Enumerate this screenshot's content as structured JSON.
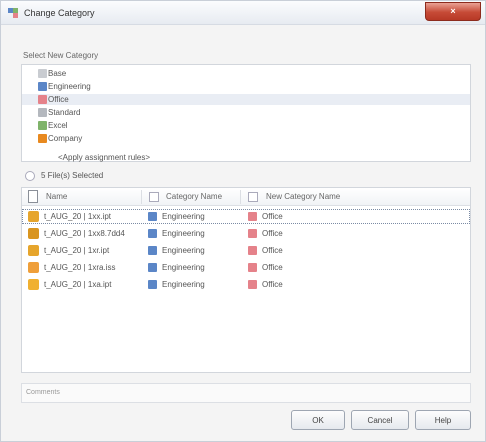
{
  "window": {
    "title": "Change Category",
    "close_label": "×"
  },
  "section": {
    "select_new_category": "Select New Category",
    "comments": "Comments"
  },
  "categories": [
    {
      "label": "Base",
      "color": "#c9ccd1"
    },
    {
      "label": "Engineering",
      "color": "#5b86c7"
    },
    {
      "label": "Office",
      "color": "#e5828a"
    },
    {
      "label": "Standard",
      "color": "#b4b8be"
    },
    {
      "label": "Excel",
      "color": "#7fb36a"
    },
    {
      "label": "Company",
      "color": "#e8891f"
    }
  ],
  "apply_rules_label": "<Apply assignment rules>",
  "files": {
    "count_label": "5 File(s) Selected",
    "columns": {
      "name": "Name",
      "category_name": "Category Name",
      "new_category_name": "New Category Name"
    },
    "rows": [
      {
        "name": "t_AUG_20 | 1xx.ipt",
        "category": "Engineering",
        "new_category": "Office",
        "icon_color": "#e6a52c"
      },
      {
        "name": "t_AUG_20 | 1xx8.7dd4",
        "category": "Engineering",
        "new_category": "Office",
        "icon_color": "#d9951f"
      },
      {
        "name": "t_AUG_20 | 1xr.ipt",
        "category": "Engineering",
        "new_category": "Office",
        "icon_color": "#e6a52c"
      },
      {
        "name": "t_AUG_20 | 1xra.iss",
        "category": "Engineering",
        "new_category": "Office",
        "icon_color": "#ef9f3a"
      },
      {
        "name": "t_AUG_20 | 1xa.ipt",
        "category": "Engineering",
        "new_category": "Office",
        "icon_color": "#f0b030"
      }
    ]
  },
  "buttons": {
    "ok": "OK",
    "cancel": "Cancel",
    "help": "Help"
  },
  "colors": {
    "engineering": "#5b86c7",
    "office": "#e5828a"
  }
}
